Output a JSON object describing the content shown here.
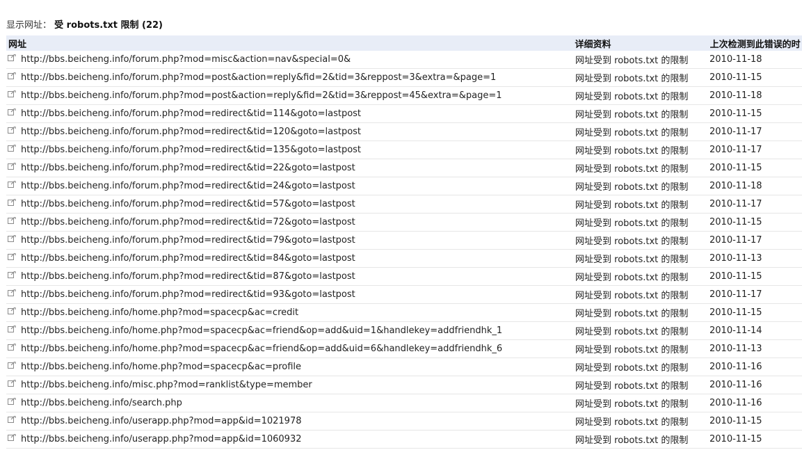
{
  "filter": {
    "label": "显示网址：",
    "value": "受 robots.txt 限制 (22)"
  },
  "table": {
    "headers": {
      "url": "网址",
      "detail": "详细资料",
      "date": "上次检测到此错误的时"
    },
    "icon": "external-link-icon",
    "rows": [
      {
        "url": "http://bbs.beicheng.info/forum.php?mod=misc&action=nav&special=0&",
        "detail": "网址受到 robots.txt 的限制",
        "date": "2010-11-18"
      },
      {
        "url": "http://bbs.beicheng.info/forum.php?mod=post&action=reply&fid=2&tid=3&reppost=3&extra=&page=1",
        "detail": "网址受到 robots.txt 的限制",
        "date": "2010-11-15"
      },
      {
        "url": "http://bbs.beicheng.info/forum.php?mod=post&action=reply&fid=2&tid=3&reppost=45&extra=&page=1",
        "detail": "网址受到 robots.txt 的限制",
        "date": "2010-11-18"
      },
      {
        "url": "http://bbs.beicheng.info/forum.php?mod=redirect&tid=114&goto=lastpost",
        "detail": "网址受到 robots.txt 的限制",
        "date": "2010-11-15"
      },
      {
        "url": "http://bbs.beicheng.info/forum.php?mod=redirect&tid=120&goto=lastpost",
        "detail": "网址受到 robots.txt 的限制",
        "date": "2010-11-17"
      },
      {
        "url": "http://bbs.beicheng.info/forum.php?mod=redirect&tid=135&goto=lastpost",
        "detail": "网址受到 robots.txt 的限制",
        "date": "2010-11-17"
      },
      {
        "url": "http://bbs.beicheng.info/forum.php?mod=redirect&tid=22&goto=lastpost",
        "detail": "网址受到 robots.txt 的限制",
        "date": "2010-11-15"
      },
      {
        "url": "http://bbs.beicheng.info/forum.php?mod=redirect&tid=24&goto=lastpost",
        "detail": "网址受到 robots.txt 的限制",
        "date": "2010-11-18"
      },
      {
        "url": "http://bbs.beicheng.info/forum.php?mod=redirect&tid=57&goto=lastpost",
        "detail": "网址受到 robots.txt 的限制",
        "date": "2010-11-17"
      },
      {
        "url": "http://bbs.beicheng.info/forum.php?mod=redirect&tid=72&goto=lastpost",
        "detail": "网址受到 robots.txt 的限制",
        "date": "2010-11-15"
      },
      {
        "url": "http://bbs.beicheng.info/forum.php?mod=redirect&tid=79&goto=lastpost",
        "detail": "网址受到 robots.txt 的限制",
        "date": "2010-11-17"
      },
      {
        "url": "http://bbs.beicheng.info/forum.php?mod=redirect&tid=84&goto=lastpost",
        "detail": "网址受到 robots.txt 的限制",
        "date": "2010-11-13"
      },
      {
        "url": "http://bbs.beicheng.info/forum.php?mod=redirect&tid=87&goto=lastpost",
        "detail": "网址受到 robots.txt 的限制",
        "date": "2010-11-15"
      },
      {
        "url": "http://bbs.beicheng.info/forum.php?mod=redirect&tid=93&goto=lastpost",
        "detail": "网址受到 robots.txt 的限制",
        "date": "2010-11-17"
      },
      {
        "url": "http://bbs.beicheng.info/home.php?mod=spacecp&ac=credit",
        "detail": "网址受到 robots.txt 的限制",
        "date": "2010-11-15"
      },
      {
        "url": "http://bbs.beicheng.info/home.php?mod=spacecp&ac=friend&op=add&uid=1&handlekey=addfriendhk_1",
        "detail": "网址受到 robots.txt 的限制",
        "date": "2010-11-14"
      },
      {
        "url": "http://bbs.beicheng.info/home.php?mod=spacecp&ac=friend&op=add&uid=6&handlekey=addfriendhk_6",
        "detail": "网址受到 robots.txt 的限制",
        "date": "2010-11-13"
      },
      {
        "url": "http://bbs.beicheng.info/home.php?mod=spacecp&ac=profile",
        "detail": "网址受到 robots.txt 的限制",
        "date": "2010-11-16"
      },
      {
        "url": "http://bbs.beicheng.info/misc.php?mod=ranklist&type=member",
        "detail": "网址受到 robots.txt 的限制",
        "date": "2010-11-16"
      },
      {
        "url": "http://bbs.beicheng.info/search.php",
        "detail": "网址受到 robots.txt 的限制",
        "date": "2010-11-16"
      },
      {
        "url": "http://bbs.beicheng.info/userapp.php?mod=app&id=1021978",
        "detail": "网址受到 robots.txt 的限制",
        "date": "2010-11-15"
      },
      {
        "url": "http://bbs.beicheng.info/userapp.php?mod=app&id=1060932",
        "detail": "网址受到 robots.txt 的限制",
        "date": "2010-11-15"
      }
    ]
  }
}
